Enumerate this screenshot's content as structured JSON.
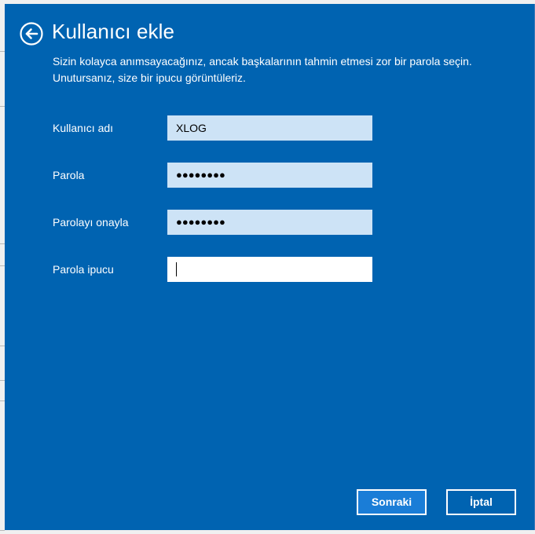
{
  "dialog": {
    "title": "Kullanıcı ekle",
    "description": "Sizin kolayca anımsayacağınız, ancak başkalarının tahmin etmesi zor bir parola seçin. Unutursanız, size bir ipucu görüntüleriz."
  },
  "form": {
    "username": {
      "label": "Kullanıcı adı",
      "value": "XLOG"
    },
    "password": {
      "label": "Parola",
      "value": "●●●●●●●●"
    },
    "confirm_password": {
      "label": "Parolayı onayla",
      "value": "●●●●●●●●"
    },
    "password_hint": {
      "label": "Parola ipucu",
      "value": ""
    }
  },
  "buttons": {
    "next_label": "Sonraki",
    "cancel_label": "İptal"
  },
  "colors": {
    "background": "#0063b1",
    "field_background": "#cde3f6",
    "primary_button": "#1a7dd7",
    "text": "#ffffff"
  },
  "icons": {
    "back": "arrow-left-circle-icon"
  }
}
